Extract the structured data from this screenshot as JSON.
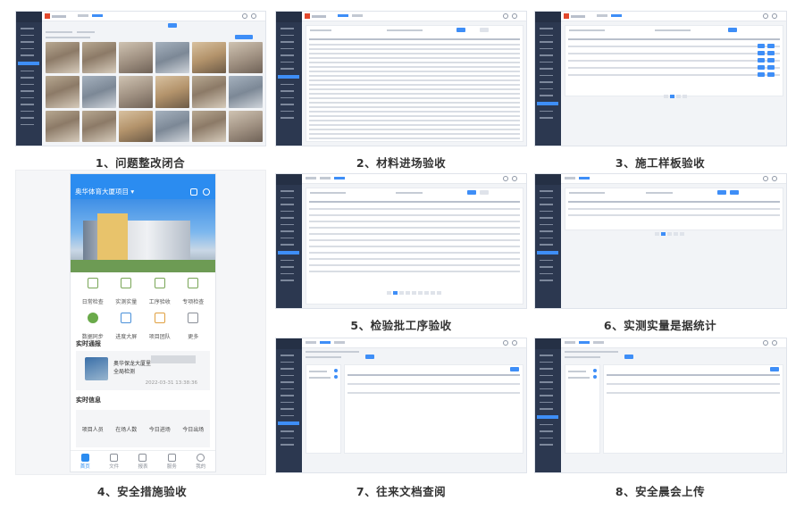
{
  "captions": [
    "1、问题整改闭合",
    "2、材料进场验收",
    "3、施工样板验收",
    "4、安全措施验收",
    "5、检验批工序验收",
    "6、实测实量是据统计",
    "7、往来文档查阅",
    "8、安全晨会上传"
  ],
  "colors": {
    "sidebar": "#2c3850",
    "accent": "#3e8ef7",
    "brand": "#e2482c",
    "mobile_header": "#2b8cf0"
  },
  "mobile": {
    "project": "奥华体育大厦项目",
    "grid": [
      "日常检查",
      "实测实量",
      "工序验收",
      "专项检查",
      "数据同步",
      "进度大屏",
      "项目团队",
      "更多"
    ],
    "section_live": "实时通报",
    "card_line1": "奥华保龙大厦里",
    "card_line2": "全局检测",
    "card_date": "2022-03-31 13:38:36",
    "section_info": "实时信息",
    "stats": [
      "项目人员",
      "在场人数",
      "今日进场",
      "今日出场"
    ],
    "tabbar": [
      "首页",
      "文件",
      "报表",
      "服务",
      "我的"
    ],
    "icons": [
      "search-icon",
      "message-icon"
    ]
  }
}
